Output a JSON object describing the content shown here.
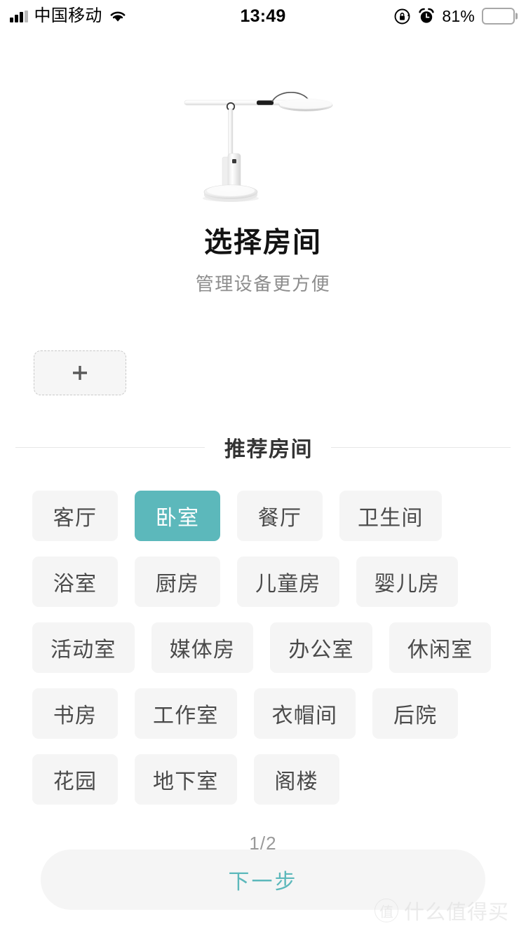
{
  "status_bar": {
    "carrier": "中国移动",
    "time": "13:49",
    "battery_percent": "81%",
    "battery_level": 81,
    "icons": {
      "signal": "signal-bars-icon",
      "wifi": "wifi-icon",
      "rotation_lock": "rotation-lock-icon",
      "alarm": "alarm-clock-icon",
      "battery": "battery-icon"
    }
  },
  "hero": {
    "image_name": "desk-lamp-illustration"
  },
  "header": {
    "title": "选择房间",
    "subtitle": "管理设备更方便"
  },
  "add_room": {
    "icon": "plus-icon",
    "label": "+"
  },
  "section": {
    "title": "推荐房间"
  },
  "rooms": [
    {
      "label": "客厅",
      "selected": false
    },
    {
      "label": "卧室",
      "selected": true
    },
    {
      "label": "餐厅",
      "selected": false
    },
    {
      "label": "卫生间",
      "selected": false
    },
    {
      "label": "浴室",
      "selected": false
    },
    {
      "label": "厨房",
      "selected": false
    },
    {
      "label": "儿童房",
      "selected": false
    },
    {
      "label": "婴儿房",
      "selected": false
    },
    {
      "label": "活动室",
      "selected": false
    },
    {
      "label": "媒体房",
      "selected": false
    },
    {
      "label": "办公室",
      "selected": false
    },
    {
      "label": "休闲室",
      "selected": false
    },
    {
      "label": "书房",
      "selected": false
    },
    {
      "label": "工作室",
      "selected": false
    },
    {
      "label": "衣帽间",
      "selected": false
    },
    {
      "label": "后院",
      "selected": false
    },
    {
      "label": "花园",
      "selected": false
    },
    {
      "label": "地下室",
      "selected": false
    },
    {
      "label": "阁楼",
      "selected": false
    }
  ],
  "pager": {
    "text": "1/2",
    "current": 1,
    "total": 2
  },
  "footer": {
    "next_label": "下一步"
  },
  "watermark": {
    "badge": "值",
    "text": "什么值得买"
  },
  "colors": {
    "accent": "#5cb8bb",
    "chip_bg": "#f5f5f5",
    "chip_text": "#4a4a4a",
    "title": "#121212",
    "subtitle": "#8d8d8d",
    "page_bg": "#ffffff"
  }
}
